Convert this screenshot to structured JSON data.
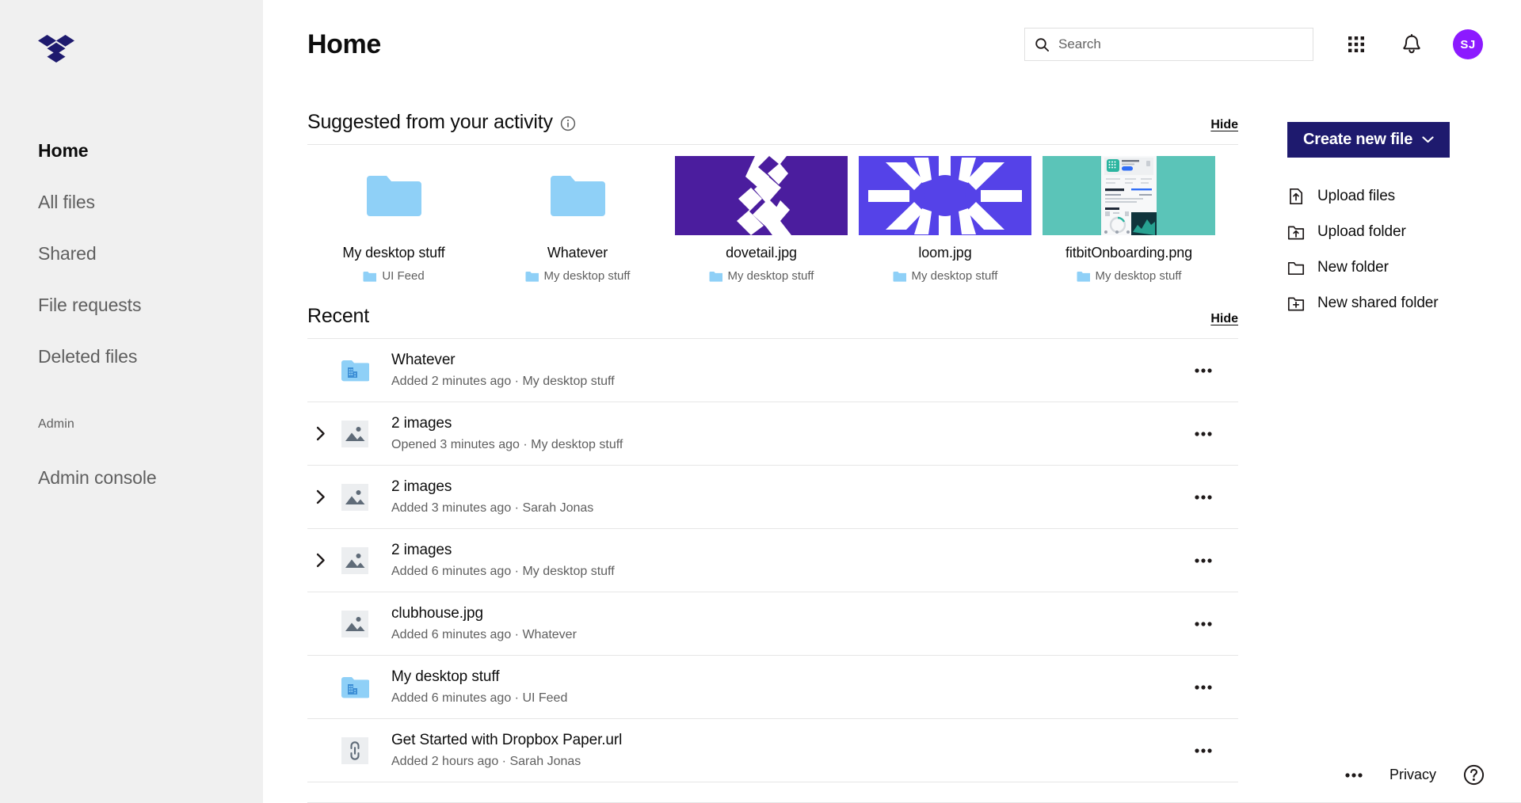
{
  "sidebar": {
    "logo_icon": "dropbox-logo",
    "logo_color": "#1e1a6e",
    "items": [
      {
        "label": "Home",
        "active": true
      },
      {
        "label": "All files",
        "active": false
      },
      {
        "label": "Shared",
        "active": false
      },
      {
        "label": "File requests",
        "active": false
      },
      {
        "label": "Deleted files",
        "active": false
      }
    ],
    "section_label": "Admin",
    "admin_item": {
      "label": "Admin console"
    }
  },
  "header": {
    "title": "Home",
    "search": {
      "placeholder": "Search",
      "value": "",
      "icon": "search-icon"
    },
    "grid_icon": "apps-grid-icon",
    "bell_icon": "notifications-bell-icon",
    "avatar": {
      "initials": "SJ",
      "color": "#8c1aff"
    }
  },
  "suggested": {
    "title": "Suggested from your activity",
    "info_icon": "info-circle-icon",
    "hide_label": "Hide",
    "cards": [
      {
        "name": "My desktop stuff",
        "location": "UI Feed",
        "kind": "folder"
      },
      {
        "name": "Whatever",
        "location": "My desktop stuff",
        "kind": "folder"
      },
      {
        "name": "dovetail.jpg",
        "location": "My desktop stuff",
        "kind": "image",
        "bg": "#4b1d9e",
        "art": "dovetail"
      },
      {
        "name": "loom.jpg",
        "location": "My desktop stuff",
        "kind": "image",
        "bg": "#5542e8",
        "art": "loom"
      },
      {
        "name": "fitbitOnboarding.png",
        "location": "My desktop stuff",
        "kind": "image",
        "bg": "#5bc4b8",
        "art": "fitbit"
      }
    ]
  },
  "recent": {
    "title": "Recent",
    "hide_label": "Hide",
    "more_icon": "overflow-menu-icon",
    "rows": [
      {
        "name": "Whatever",
        "meta": "Added 2 minutes ago · My desktop stuff",
        "icon": "shared-folder-icon",
        "expandable": false
      },
      {
        "name": "2 images",
        "meta": "Opened 3 minutes ago · My desktop stuff",
        "icon": "image-group-icon",
        "expandable": true
      },
      {
        "name": "2 images",
        "meta": "Added 3 minutes ago · Sarah Jonas",
        "icon": "image-group-icon",
        "expandable": true
      },
      {
        "name": "2 images",
        "meta": "Added 6 minutes ago · My desktop stuff",
        "icon": "image-group-icon",
        "expandable": true
      },
      {
        "name": "clubhouse.jpg",
        "meta": "Added 6 minutes ago · Whatever",
        "icon": "image-icon",
        "expandable": false
      },
      {
        "name": "My desktop stuff",
        "meta": "Added 6 minutes ago · UI Feed",
        "icon": "shared-folder-icon",
        "expandable": false
      },
      {
        "name": "Get Started with Dropbox Paper.url",
        "meta": "Added 2 hours ago · Sarah Jonas",
        "icon": "link-icon",
        "expandable": false
      }
    ]
  },
  "right_panel": {
    "create_button": {
      "label": "Create new file",
      "chevron_icon": "chevron-down-icon",
      "color": "#1e1a6e"
    },
    "actions": [
      {
        "label": "Upload files",
        "icon": "upload-file-icon"
      },
      {
        "label": "Upload folder",
        "icon": "upload-folder-icon"
      },
      {
        "label": "New folder",
        "icon": "new-folder-icon"
      },
      {
        "label": "New shared folder",
        "icon": "new-shared-folder-icon"
      }
    ]
  },
  "footer": {
    "dots_icon": "overflow-menu-icon",
    "privacy_label": "Privacy",
    "help_icon": "help-circle-icon"
  }
}
